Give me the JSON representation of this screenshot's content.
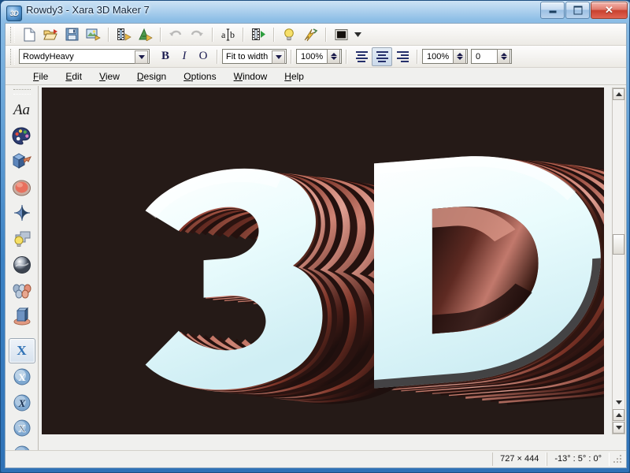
{
  "window": {
    "title": "Rowdy3 - Xara 3D Maker 7",
    "app_icon": "3D",
    "minimize_label": "Minimize",
    "maximize_label": "Maximize",
    "close_label": "✕"
  },
  "toolbar_main": {
    "items": [
      {
        "name": "new-document",
        "icon": "page-icon"
      },
      {
        "name": "open-document",
        "icon": "folder-open-icon"
      },
      {
        "name": "save-document",
        "icon": "floppy-disk-icon"
      },
      {
        "name": "export-image",
        "icon": "export-image-icon"
      },
      {
        "name": "export-animation",
        "icon": "film-export-icon"
      },
      {
        "name": "export-flash",
        "icon": "flash-export-icon"
      },
      {
        "name": "undo",
        "icon": "undo-arrow-icon",
        "disabled": true
      },
      {
        "name": "redo",
        "icon": "redo-arrow-icon",
        "disabled": true
      },
      {
        "name": "text-options",
        "icon": "text-ab-icon"
      },
      {
        "name": "animation-preview",
        "icon": "film-play-icon"
      },
      {
        "name": "lighting",
        "icon": "lightbulb-icon"
      },
      {
        "name": "quick-shade",
        "icon": "lightning-bolt-icon"
      },
      {
        "name": "background-colour",
        "icon": "colour-swatch-icon"
      },
      {
        "name": "background-colour-dropdown",
        "icon": "chevron-down-icon"
      }
    ]
  },
  "toolbar_format": {
    "font": {
      "value": "RowdyHeavy",
      "label": "Font"
    },
    "bold_label": "B",
    "italic_label": "I",
    "outline_label": "O",
    "fit": {
      "value": "Fit to width",
      "label": "Text fitting"
    },
    "size_percent": "100%",
    "tracking_percent": "100%",
    "leading_value": "0",
    "align": {
      "left_label": "Align left",
      "centre_label": "Align centre",
      "right_label": "Align right",
      "selected": "centre"
    }
  },
  "menubar": {
    "items": [
      {
        "label": "File",
        "accesskey": "F",
        "rest": "ile"
      },
      {
        "label": "Edit",
        "accesskey": "E",
        "rest": "dit"
      },
      {
        "label": "View",
        "accesskey": "V",
        "rest": "iew"
      },
      {
        "label": "Design",
        "accesskey": "D",
        "rest": "esign"
      },
      {
        "label": "Options",
        "accesskey": "O",
        "rest": "ptions"
      },
      {
        "label": "Window",
        "accesskey": "W",
        "rest": "indow"
      },
      {
        "label": "Help",
        "accesskey": "H",
        "rest": "elp"
      }
    ]
  },
  "sidebar": {
    "tools": [
      {
        "name": "text-options-tool",
        "icon": "text-aa-icon",
        "label": "Aa"
      },
      {
        "name": "colour-options-tool",
        "icon": "palette-icon"
      },
      {
        "name": "extrude-options-tool",
        "icon": "extrude-block-icon"
      },
      {
        "name": "bevel-options-tool",
        "icon": "bevel-sphere-icon"
      },
      {
        "name": "shadow-options-tool",
        "icon": "shadow-diamond-icon"
      },
      {
        "name": "lighting-options-tool",
        "icon": "lightbulb-shape-icon"
      },
      {
        "name": "texture-options-tool",
        "icon": "texture-sphere-icon"
      },
      {
        "name": "animation-options-tool",
        "icon": "animation-rollers-icon"
      },
      {
        "name": "display-options-tool",
        "icon": "display-cylinder-icon"
      }
    ],
    "templates": [
      {
        "name": "template-style-1",
        "icon": "xara-x-solid-icon",
        "selected": true
      },
      {
        "name": "template-style-2",
        "icon": "xara-x-round-icon",
        "selected": false
      },
      {
        "name": "template-style-3",
        "icon": "xara-x-script-icon",
        "selected": false
      },
      {
        "name": "template-style-4",
        "icon": "xara-x-outline-icon",
        "selected": false
      },
      {
        "name": "template-style-5",
        "icon": "xara-x-fancy-icon",
        "selected": false
      }
    ]
  },
  "canvas": {
    "text": "3D",
    "background_colour": "#251a17",
    "face_colour": "#e8fbfd",
    "extrude_colour": "#c8776a",
    "extrude_shadow_colour": "#2c1513"
  },
  "statusbar": {
    "dimensions": "727 × 444",
    "rotation": "-13° : 5° : 0°"
  },
  "scrollbars": {
    "vertical_top_arrow": "▲",
    "vertical_bottom_arrow": "▼",
    "horizontal_left_arrow": "◀"
  }
}
